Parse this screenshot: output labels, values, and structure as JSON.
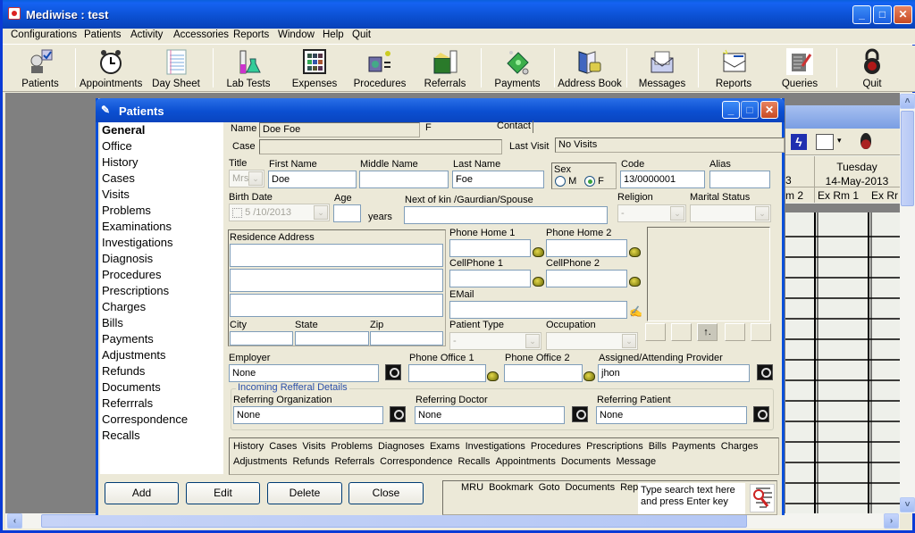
{
  "app": {
    "title": "Mediwise : test",
    "window_buttons": {
      "minimize": "_",
      "maximize": "□",
      "close": "✕"
    }
  },
  "menu": [
    "Configurations",
    "Patients",
    "Activity",
    "Accessories",
    "Reports",
    "Window",
    "Help",
    "Quit"
  ],
  "toolbar": [
    {
      "label": "Patients",
      "icon": "patient-icon"
    },
    {
      "label": "Appointments",
      "icon": "alarm-clock-icon"
    },
    {
      "label": "Day Sheet",
      "icon": "notepad-icon"
    },
    {
      "label": "Lab Tests",
      "icon": "lab-flask-icon"
    },
    {
      "label": "Expenses",
      "icon": "calculator-icon"
    },
    {
      "label": "Procedures",
      "icon": "procedures-icon"
    },
    {
      "label": "Referrals",
      "icon": "referral-box-icon"
    },
    {
      "label": "Payments",
      "icon": "money-icon"
    },
    {
      "label": "Address Book",
      "icon": "address-book-icon"
    },
    {
      "label": "Messages",
      "icon": "envelope-icon"
    },
    {
      "label": "Reports",
      "icon": "report-icon"
    },
    {
      "label": "Queries",
      "icon": "query-icon"
    },
    {
      "label": "Quit",
      "icon": "padlock-icon"
    }
  ],
  "background_window": {
    "day": "Tuesday",
    "date": "14-May-2013",
    "partial_left": "3",
    "rooms": [
      "m 2",
      "Ex Rm 1",
      "Ex Rr"
    ]
  },
  "patients_window": {
    "title": "Patients",
    "nav": [
      "General",
      "Office",
      "History",
      "Cases",
      "Visits",
      "Problems",
      "Examinations",
      "Investigations",
      "Diagnosis",
      "Procedures",
      "Prescriptions",
      "Charges",
      "Bills",
      "Payments",
      "Adjustments",
      "Refunds",
      "Documents",
      "Referrrals",
      "Correspondence",
      "Recalls"
    ],
    "active_nav": "General",
    "header": {
      "name_label": "Name",
      "name_value": "Doe  Foe",
      "sex_value": "F",
      "contact_label": "Contact",
      "contact_value": "",
      "case_label": "Case",
      "case_value": "",
      "last_visit_label": "Last Visit",
      "last_visit_value": "No Visits"
    },
    "form": {
      "title_label": "Title",
      "title_value": "Mrs.",
      "first_name_label": "First Name",
      "first_name_value": "Doe",
      "middle_name_label": "Middle Name",
      "middle_name_value": "",
      "last_name_label": "Last Name",
      "last_name_value": "Foe",
      "sex_label": "Sex",
      "sex_options": [
        "M",
        "F"
      ],
      "sex_selected": "F",
      "code_label": "Code",
      "code_value": "13/0000001",
      "alias_label": "Alias",
      "alias_value": "",
      "birth_date_label": "Birth Date",
      "birth_date_value": "5 /10/2013",
      "age_label": "Age",
      "age_value": "",
      "years_label": "years",
      "next_of_kin_label": "Next of kin /Gaurdian/Spouse",
      "next_of_kin_value": "",
      "religion_label": "Religion",
      "religion_value": "-",
      "marital_status_label": "Marital Status",
      "marital_status_value": "",
      "residence_address_label": "Residence Address",
      "address_lines": [
        "",
        "",
        ""
      ],
      "city_label": "City",
      "state_label": "State",
      "zip_label": "Zip",
      "phone_home1_label": "Phone Home 1",
      "phone_home2_label": "Phone Home 2",
      "cellphone1_label": "CellPhone 1",
      "cellphone2_label": "CellPhone 2",
      "email_label": "EMail",
      "email_value": "",
      "patient_type_label": "Patient Type",
      "patient_type_value": "-",
      "occupation_label": "Occupation",
      "occupation_value": "",
      "employer_label": "Employer",
      "employer_value": "None",
      "phone_office1_label": "Phone Office 1",
      "phone_office2_label": "Phone Office 2",
      "provider_label": "Assigned/Attending Provider",
      "provider_value": "jhon",
      "referral_group_label": "Incoming Refferal Details",
      "ref_org_label": "Referring Organization",
      "ref_org_value": "None",
      "ref_doctor_label": "Referring Doctor",
      "ref_doctor_value": "None",
      "ref_patient_label": "Referring Patient",
      "ref_patient_value": "None",
      "photo_upload_label": "↑."
    },
    "quick_links_row1": [
      "History",
      "Cases",
      "Visits",
      "Problems",
      "Diagnoses",
      "Exams",
      "Investigations",
      "Procedures",
      "Prescriptions",
      "Bills",
      "Payments",
      "Charges"
    ],
    "quick_links_row2": [
      "Adjustments",
      "Refunds",
      "Referrals",
      "Correspondence",
      "Recalls",
      "Appointments",
      "Documents",
      "Message"
    ],
    "buttons": {
      "add": "Add",
      "edit": "Edit",
      "delete": "Delete",
      "close": "Close"
    },
    "bottom_links": [
      "MRU",
      "Bookmark",
      "Goto",
      "Documents",
      "Reports"
    ],
    "search_placeholder": "Type search text here and press Enter key"
  },
  "colors": {
    "titlebar": "#0b4fd1",
    "face": "#ece9d8",
    "mdi": "#808080",
    "accent_link": "#2b4fa8"
  }
}
